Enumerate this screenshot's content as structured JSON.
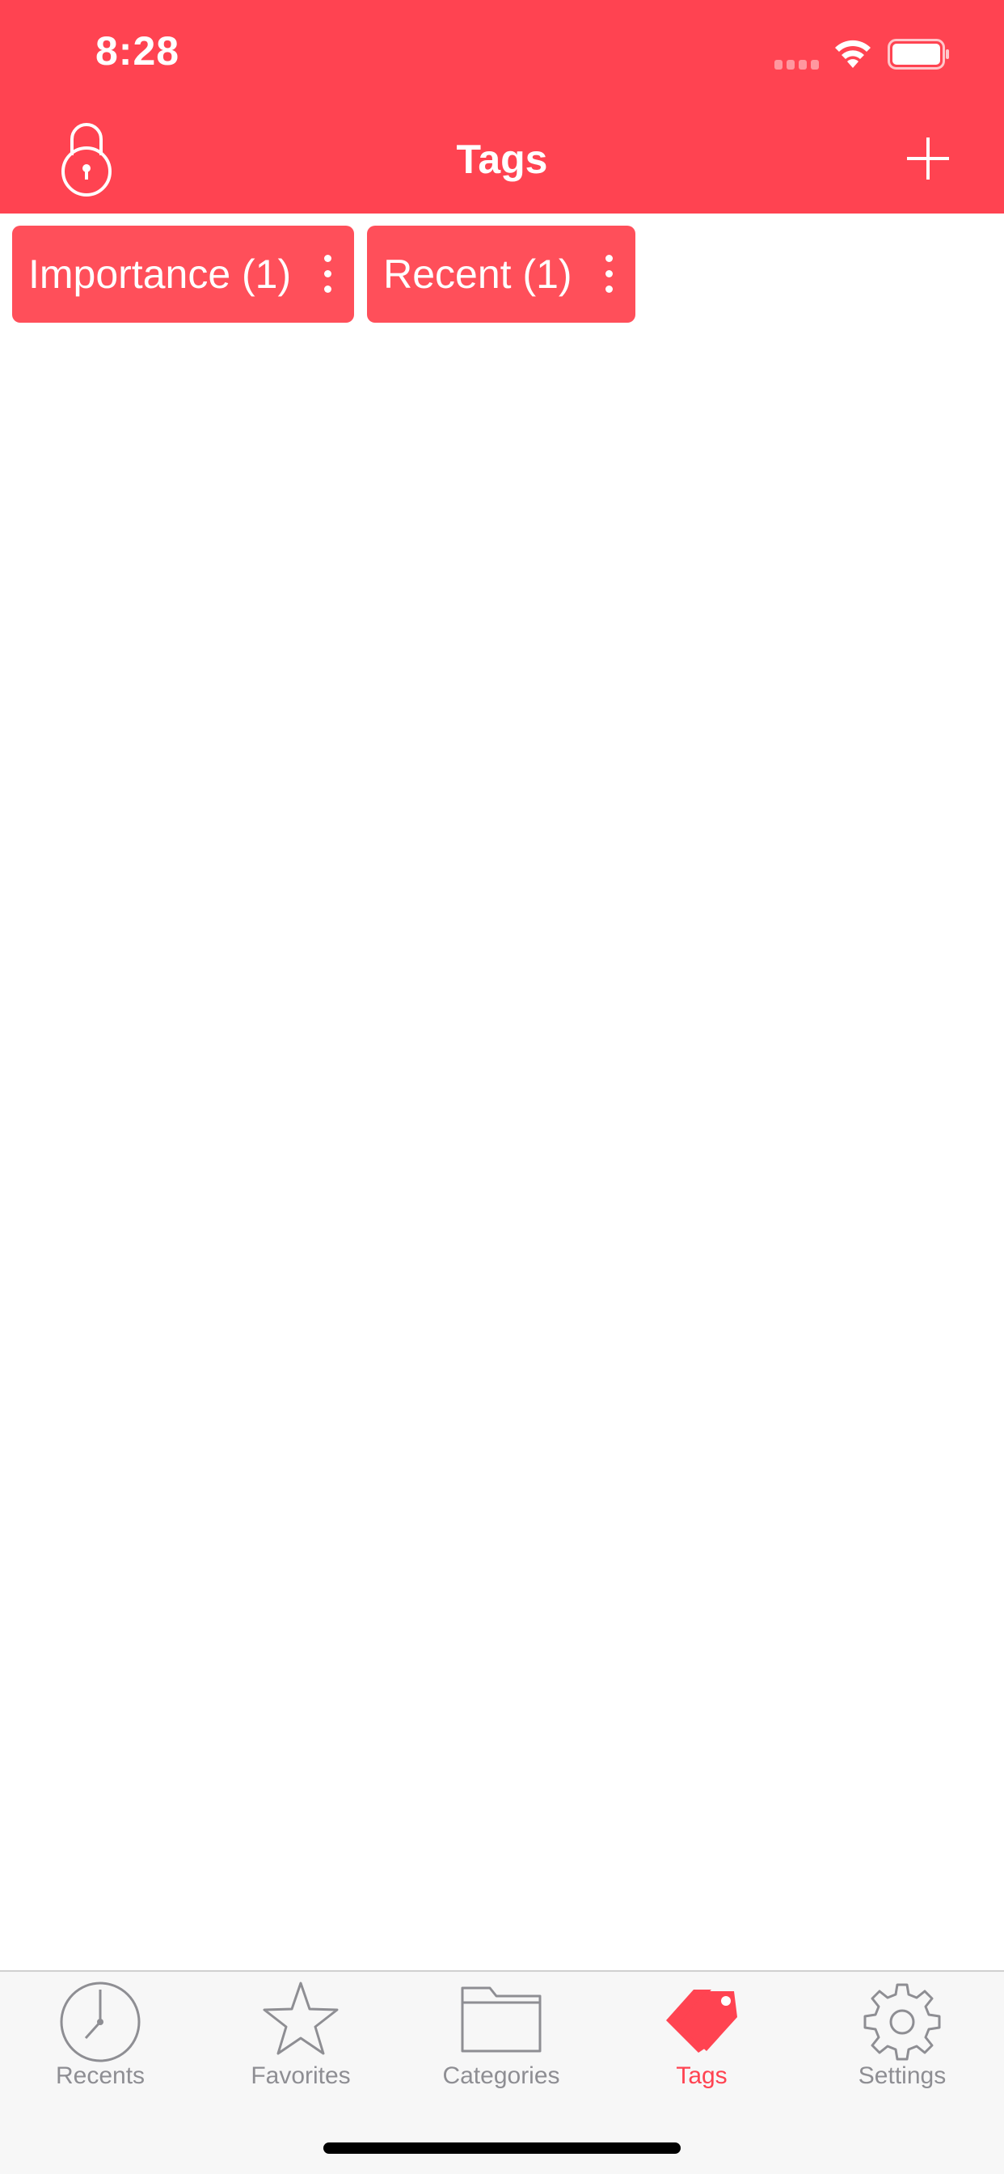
{
  "status": {
    "time": "8:28"
  },
  "nav": {
    "title": "Tags"
  },
  "tags": [
    {
      "label": "Importance (1)"
    },
    {
      "label": "Recent (1)"
    }
  ],
  "tabbar": {
    "items": [
      {
        "label": "Recents",
        "icon": "clock-icon"
      },
      {
        "label": "Favorites",
        "icon": "star-icon"
      },
      {
        "label": "Categories",
        "icon": "folder-icon"
      },
      {
        "label": "Tags",
        "icon": "tag-icon",
        "active": true
      },
      {
        "label": "Settings",
        "icon": "gear-icon"
      }
    ]
  },
  "colors": {
    "accent": "#FF4351",
    "tag_bg": "#FF4F5A",
    "tab_inactive": "#8E8E93",
    "tabbar_bg": "#F7F7F7"
  }
}
